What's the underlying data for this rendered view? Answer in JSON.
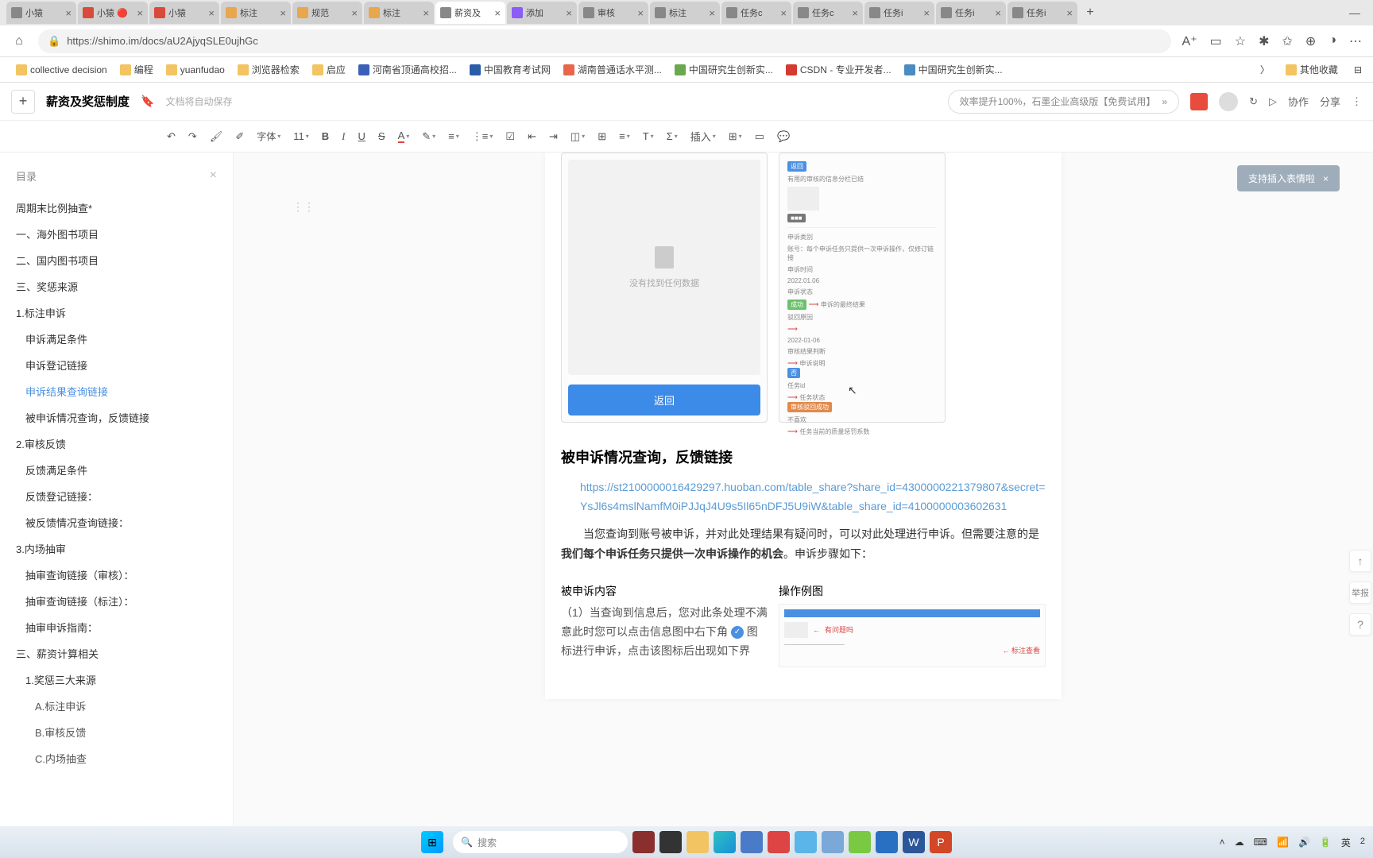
{
  "browser": {
    "tabs": [
      {
        "title": "小猿",
        "favicon": "gray"
      },
      {
        "title": "小猿 🔴",
        "favicon": "red"
      },
      {
        "title": "小猿",
        "favicon": "red"
      },
      {
        "title": "标注",
        "favicon": "orange"
      },
      {
        "title": "规范",
        "favicon": "orange"
      },
      {
        "title": "标注",
        "favicon": "orange"
      },
      {
        "title": "薪资及",
        "favicon": "gray",
        "active": true
      },
      {
        "title": "添加",
        "favicon": "purple"
      },
      {
        "title": "审核",
        "favicon": "gray"
      },
      {
        "title": "标注",
        "favicon": "gray"
      },
      {
        "title": "任务c",
        "favicon": "gray"
      },
      {
        "title": "任务c",
        "favicon": "gray"
      },
      {
        "title": "任务i",
        "favicon": "gray"
      },
      {
        "title": "任务i",
        "favicon": "gray"
      },
      {
        "title": "任务i",
        "favicon": "gray"
      }
    ],
    "url": "https://shimo.im/docs/aU2AjyqSLE0ujhGc"
  },
  "bookmarks": [
    {
      "type": "folder",
      "label": "collective decision"
    },
    {
      "type": "folder",
      "label": "编程"
    },
    {
      "type": "folder",
      "label": "yuanfudao"
    },
    {
      "type": "folder",
      "label": "浏览器检索"
    },
    {
      "type": "folder",
      "label": "启应"
    },
    {
      "type": "link",
      "label": "河南省顶通高校招...",
      "color": "#3a5fb8"
    },
    {
      "type": "link",
      "label": "中国教育考试网",
      "color": "#2a5caa"
    },
    {
      "type": "link",
      "label": "湖南普通话水平测...",
      "color": "#e8674a"
    },
    {
      "type": "link",
      "label": "中国研究生创新实...",
      "color": "#6aa84f"
    },
    {
      "type": "link",
      "label": "CSDN - 专业开发者...",
      "color": "#d43a2f"
    },
    {
      "type": "link",
      "label": "中国研究生创新实...",
      "color": "#4a8bc2"
    }
  ],
  "bookmarks_more": "其他收藏",
  "shimo": {
    "title": "薪资及奖惩制度",
    "autosave": "文档将自动保存",
    "promo": "效率提升100%，石墨企业高级版【免费试用】",
    "collab": "协作",
    "share": "分享"
  },
  "toolbar": {
    "font_label": "字体",
    "font_size": "11",
    "insert": "插入"
  },
  "outline": {
    "heading": "目录",
    "items": [
      {
        "level": 1,
        "text": "周期末比例抽查*"
      },
      {
        "level": 1,
        "text": "一、海外图书项目"
      },
      {
        "level": 1,
        "text": "二、国内图书项目"
      },
      {
        "level": 1,
        "text": "三、奖惩来源"
      },
      {
        "level": 1,
        "text": "1.标注申诉"
      },
      {
        "level": 2,
        "text": "申诉满足条件"
      },
      {
        "level": 2,
        "text": "申诉登记链接"
      },
      {
        "level": 2,
        "text": "申诉结果查询链接",
        "active": true
      },
      {
        "level": 2,
        "text": "被申诉情况查询，反馈链接"
      },
      {
        "level": 1,
        "text": "2.审核反馈"
      },
      {
        "level": 2,
        "text": "反馈满足条件"
      },
      {
        "level": 2,
        "text": "反馈登记链接："
      },
      {
        "level": 2,
        "text": "被反馈情况查询链接："
      },
      {
        "level": 1,
        "text": "3.内场抽审"
      },
      {
        "level": 2,
        "text": "抽审查询链接（审核）："
      },
      {
        "level": 2,
        "text": "抽审查询链接（标注）："
      },
      {
        "level": 2,
        "text": "抽审申诉指南："
      },
      {
        "level": 1,
        "text": "三、薪资计算相关"
      },
      {
        "level": 2,
        "text": "1.奖惩三大来源"
      },
      {
        "level": 3,
        "text": "A.标注申诉"
      },
      {
        "level": 3,
        "text": "B.审核反馈"
      },
      {
        "level": 3,
        "text": "C.内场抽查"
      }
    ]
  },
  "doc": {
    "embed_left": {
      "nodata": "没有找到任何数据",
      "back_btn": "返回"
    },
    "embed_right": {
      "top_tag": "返回",
      "line1": "有用的审核的信息分栏已结",
      "line2": "申诉类别",
      "line3": "账号：每个申诉任务只提供一次申诉操作，仅修订链接",
      "date_label": "申诉时间",
      "date": "2022.01.06",
      "status_label": "申诉状态",
      "status_green": "成功",
      "status_anno": "申诉的最终结果",
      "reject_label": "驳回原因",
      "reject_date": "2022-01-06",
      "audit_label": "审核结果判断",
      "audit_anno": "申诉说明",
      "square_tag": "否",
      "task_label": "任务id",
      "task_anno": "任务状态",
      "task_btn": "审核驳回成功",
      "bottom_label": "不喜欢",
      "bottom_anno": "任务当前的质量惩罚系数"
    },
    "h3": "被申诉情况查询，反馈链接",
    "link": "https://st2100000016429297.huoban.com/table_share?share_id=4300000221379807&secret=YsJl6s4mslNamfM0iPJJqJ4U9s5Il65nDFJ5U9iW&table_share_id=4100000003602631",
    "body_prefix": "当您查询到账号被申诉，并对此处理结果有疑问时，可以对此处理进行申诉。但需要注意的是",
    "body_emph": "我们每个申诉任务只提供一次申诉操作的机会",
    "body_suffix": "。申诉步骤如下：",
    "tbl_left_h": "被申诉内容",
    "tbl_right_h": "操作例图",
    "tbl_left_body": "（1）当查询到信息后，您对此条处理不满意此时您可以点击信息图中右下角",
    "tbl_left_body2": "图标进行申诉，点击该图标后出现如下界",
    "tbl_img_anno1": "有问题吗",
    "tbl_img_anno2": "标注查看"
  },
  "tip": {
    "text": "支持插入表情啦"
  },
  "float": {
    "up": "↑",
    "hand": "举报",
    "help": "?"
  },
  "taskbar": {
    "search_ph": "搜索",
    "ime": "英",
    "time": "2",
    "date": ""
  }
}
